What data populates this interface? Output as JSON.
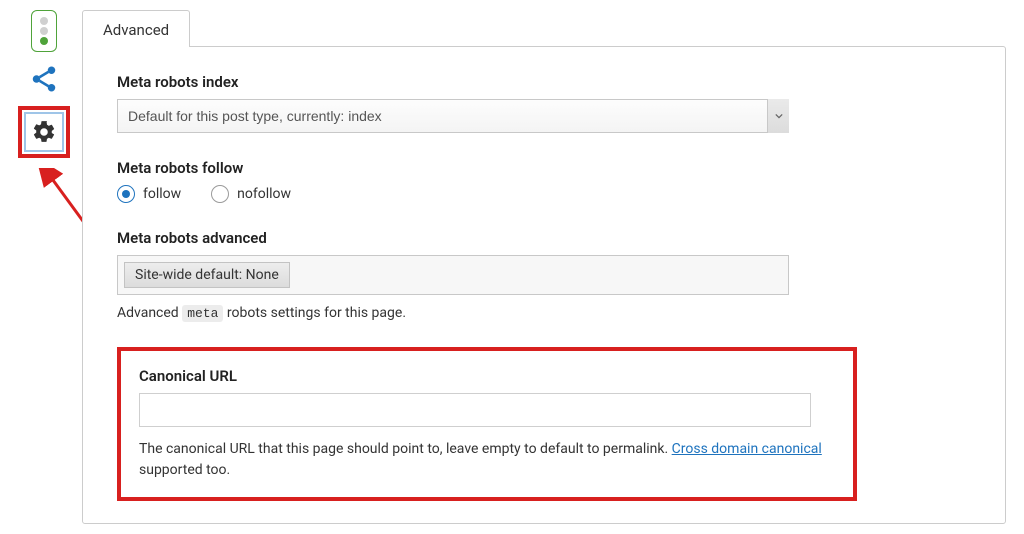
{
  "tab": {
    "label": "Advanced"
  },
  "metaIndex": {
    "label": "Meta robots index",
    "value": "Default for this post type, currently: index"
  },
  "metaFollow": {
    "label": "Meta robots follow",
    "options": [
      {
        "label": "follow",
        "selected": true
      },
      {
        "label": "nofollow",
        "selected": false
      }
    ]
  },
  "metaAdvanced": {
    "label": "Meta robots advanced",
    "selected_option": "Site-wide default: None",
    "help_pre": "Advanced ",
    "help_code": "meta",
    "help_post": " robots settings for this page."
  },
  "canonical": {
    "label": "Canonical URL",
    "value": "",
    "desc_pre": "The canonical URL that this page should point to, leave empty to default to permalink. ",
    "link_text": "Cross domain canonical",
    "desc_post": " supported too."
  }
}
